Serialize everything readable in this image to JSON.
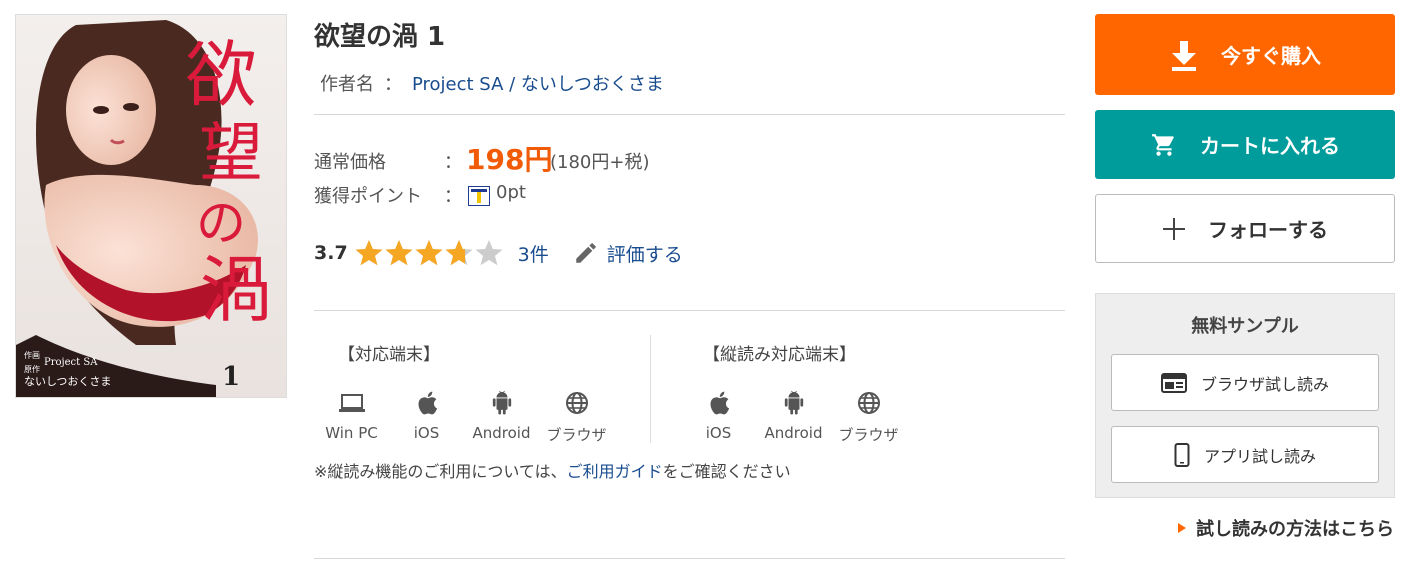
{
  "product": {
    "title": "欲望の渦 1",
    "author_label": "作者名",
    "author_sep": "：",
    "author1": "Project SA",
    "author_slash": " / ",
    "author2": "ないしつおくさま"
  },
  "cover": {
    "title_chars": "欲望の渦",
    "volume": "1",
    "credit_line1_label": "作画",
    "credit_line1": "Project SA",
    "credit_line2_label": "原作",
    "credit_line2": "ないしつおくさま"
  },
  "price": {
    "label": "通常価格",
    "colon": "：",
    "value": "198円",
    "tax_note": "(180円+税)"
  },
  "points": {
    "label": "獲得ポイント",
    "colon": "：",
    "icon": "t-point-icon",
    "value": "0pt"
  },
  "rating": {
    "score": "3.7",
    "stars_value": 3.7,
    "stars_max": 5,
    "count": "3件",
    "review_label": "評価する",
    "star_color": "#f5a623",
    "star_empty_color": "#cccccc"
  },
  "devices": {
    "supported_heading": "【対応端末】",
    "supported": [
      {
        "icon": "laptop-icon",
        "label": "Win PC"
      },
      {
        "icon": "apple-icon",
        "label": "iOS"
      },
      {
        "icon": "android-icon",
        "label": "Android"
      },
      {
        "icon": "globe-icon",
        "label": "ブラウザ"
      }
    ],
    "vertical_heading": "【縦読み対応端末】",
    "vertical": [
      {
        "icon": "apple-icon",
        "label": "iOS"
      },
      {
        "icon": "android-icon",
        "label": "Android"
      },
      {
        "icon": "globe-icon",
        "label": "ブラウザ"
      }
    ]
  },
  "note": {
    "prefix": "※縦読み機能のご利用については、",
    "link": "ご利用ガイド",
    "suffix": "をご確認ください"
  },
  "actions": {
    "buy_label": "今すぐ購入",
    "cart_label": "カートに入れる",
    "follow_label": "フォローする",
    "buy_color": "#ff6600",
    "cart_color": "#009b9b"
  },
  "sample": {
    "title": "無料サンプル",
    "browser_label": "ブラウザ試し読み",
    "app_label": "アプリ試し読み",
    "howto_label": "試し読みの方法はこちら"
  }
}
